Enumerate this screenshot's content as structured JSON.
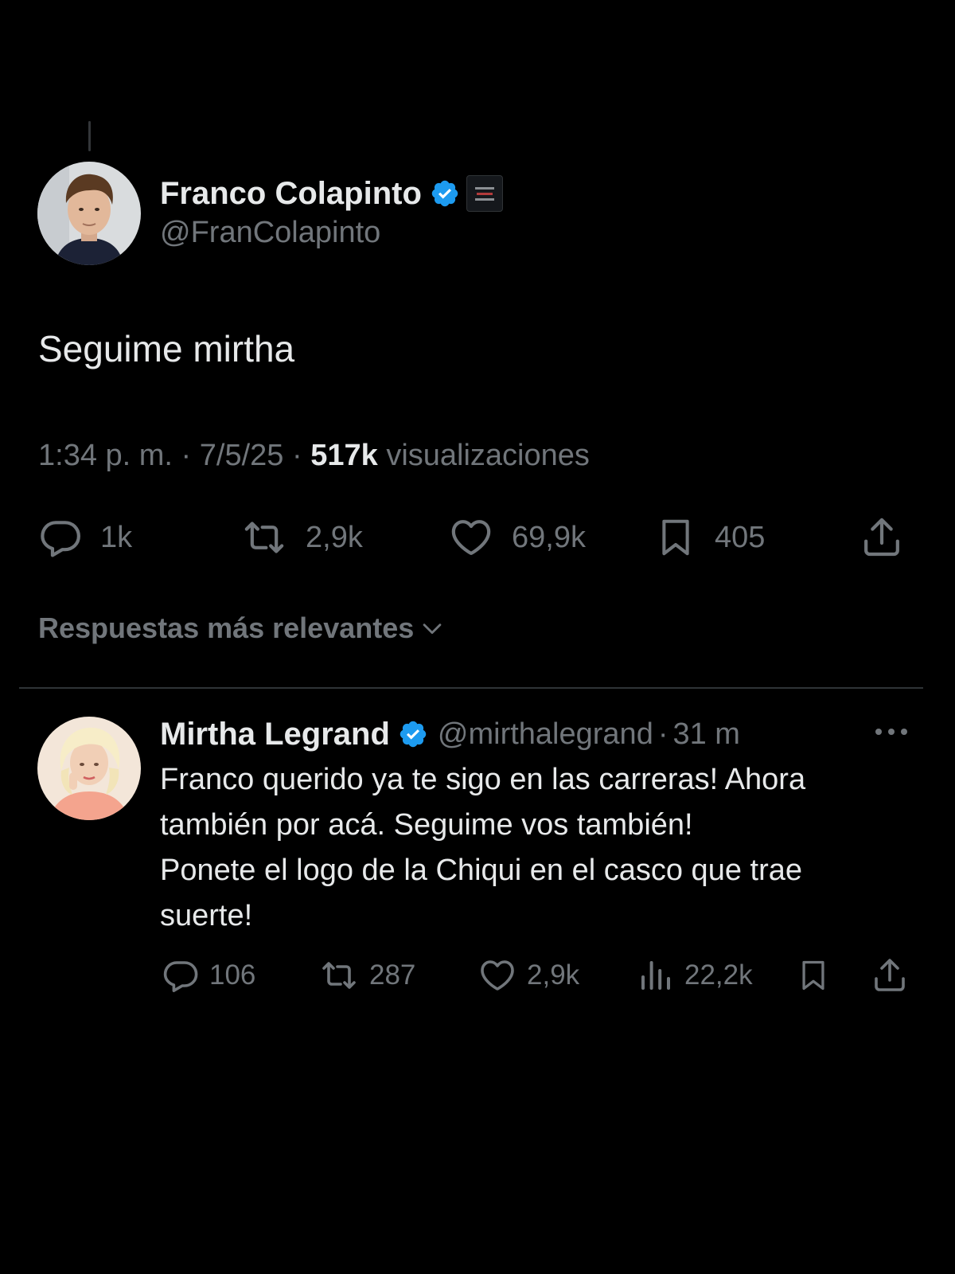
{
  "tweet": {
    "author_name": "Franco Colapinto",
    "author_handle": "@FranColapinto",
    "text": "Seguime mirtha",
    "time": "1:34 p. m.",
    "date": "7/5/25",
    "separator": "·",
    "views_count": "517k",
    "views_label": "visualizaciones",
    "actions": {
      "replies": "1k",
      "reposts": "2,9k",
      "likes": "69,9k",
      "bookmarks": "405"
    }
  },
  "replies_section": {
    "sort_label": "Respuestas más relevantes"
  },
  "reply": {
    "author_name": "Mirtha Legrand",
    "author_handle": "@mirthalegrand",
    "separator": "·",
    "time": "31 m",
    "text_lines": [
      "Franco querido ya te sigo en las carreras! Ahora",
      "también por acá. Seguime vos también!",
      "Ponete el logo de la Chiqui en el casco que trae",
      "suerte!"
    ],
    "actions": {
      "replies": "106",
      "reposts": "287",
      "likes": "2,9k",
      "views": "22,2k"
    }
  },
  "icons": {
    "verified": "verified-badge-icon",
    "reply": "reply-icon",
    "repost": "repost-icon",
    "like": "heart-icon",
    "bookmark": "bookmark-icon",
    "share": "share-icon",
    "views": "views-icon",
    "more": "more-icon",
    "chevron": "chevron-down-icon"
  },
  "colors": {
    "background": "#000000",
    "primary_text": "#e7e9ea",
    "secondary_text": "#71767b",
    "verified": "#1d9bf0",
    "divider": "#2f3336"
  }
}
